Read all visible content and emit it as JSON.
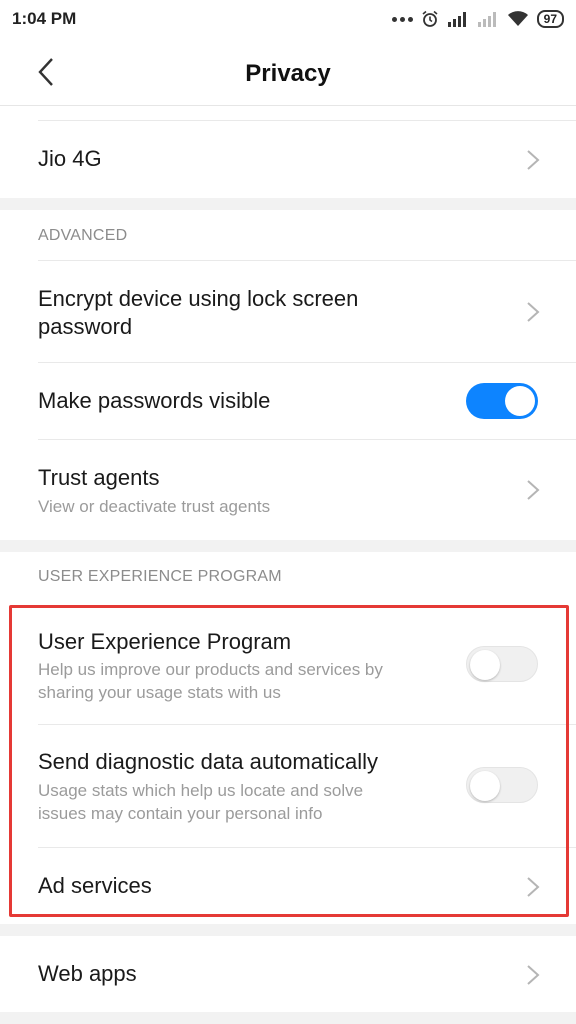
{
  "status_bar": {
    "time": "1:04 PM",
    "battery": "97"
  },
  "header": {
    "title": "Privacy",
    "back_icon": "chevron-left-icon"
  },
  "items": {
    "jio": {
      "title": "Jio 4G"
    },
    "advanced_label": "ADVANCED",
    "encrypt": {
      "title_line1": "Encrypt device using lock screen",
      "title_line2": "password"
    },
    "passwords_visible": {
      "title": "Make passwords visible",
      "enabled": true
    },
    "trust_agents": {
      "title": "Trust agents",
      "subtitle": "View or deactivate trust agents"
    },
    "uxp_label": "USER EXPERIENCE PROGRAM",
    "uxp": {
      "title": "User Experience Program",
      "subtitle_line1": "Help us improve our products and services by",
      "subtitle_line2": "sharing your usage stats with us",
      "enabled": false
    },
    "diagnostic": {
      "title": "Send diagnostic data automatically",
      "subtitle_line1": "Usage stats which help us locate and solve",
      "subtitle_line2": "issues may contain your personal info",
      "enabled": false
    },
    "ad_services": {
      "title": "Ad services"
    },
    "web_apps": {
      "title": "Web apps"
    }
  },
  "colors": {
    "accent": "#0d84ff",
    "highlight": "#e53935",
    "background": "#f2f2f2"
  }
}
